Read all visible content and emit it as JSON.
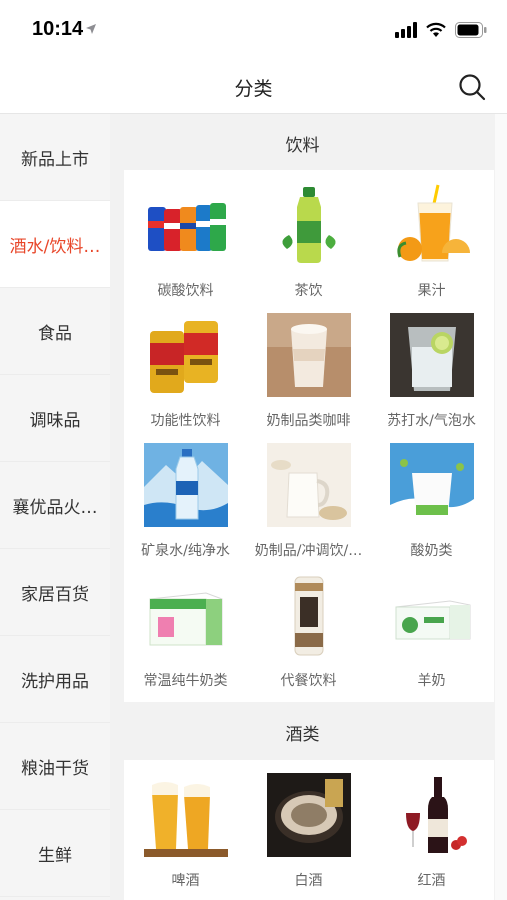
{
  "status": {
    "time": "10:14"
  },
  "header": {
    "title": "分类"
  },
  "sidebar": {
    "items": [
      {
        "label": "新品上市",
        "active": false
      },
      {
        "label": "酒水/饮料…",
        "active": true
      },
      {
        "label": "食品",
        "active": false
      },
      {
        "label": "调味品",
        "active": false
      },
      {
        "label": "襄优品火…",
        "active": false
      },
      {
        "label": "家居百货",
        "active": false
      },
      {
        "label": "洗护用品",
        "active": false
      },
      {
        "label": "粮油干货",
        "active": false
      },
      {
        "label": "生鲜",
        "active": false
      }
    ]
  },
  "sections": [
    {
      "title": "饮料",
      "items": [
        {
          "label": "碳酸饮料",
          "icon": "soda-cans-icon"
        },
        {
          "label": "茶饮",
          "icon": "green-tea-bottle-icon"
        },
        {
          "label": "果汁",
          "icon": "orange-juice-icon"
        },
        {
          "label": "功能性饮料",
          "icon": "energy-drink-cans-icon"
        },
        {
          "label": "奶制品类咖啡",
          "icon": "milk-coffee-icon"
        },
        {
          "label": "苏打水/气泡水",
          "icon": "soda-water-glass-icon"
        },
        {
          "label": "矿泉水/纯净水",
          "icon": "mineral-water-bottle-icon"
        },
        {
          "label": "奶制品/冲调饮/…",
          "icon": "milk-jug-icon"
        },
        {
          "label": "酸奶类",
          "icon": "yogurt-cup-icon"
        },
        {
          "label": "常温纯牛奶类",
          "icon": "milk-box-icon"
        },
        {
          "label": "代餐饮料",
          "icon": "meal-drink-can-icon"
        },
        {
          "label": "羊奶",
          "icon": "goat-milk-box-icon"
        }
      ]
    },
    {
      "title": "酒类",
      "items": [
        {
          "label": "啤酒",
          "icon": "beer-glasses-icon"
        },
        {
          "label": "白酒",
          "icon": "baijiu-bowl-icon"
        },
        {
          "label": "红酒",
          "icon": "red-wine-bottle-icon"
        }
      ]
    }
  ],
  "colors": {
    "accent": "#e8472a",
    "sidebar_bg": "#f5f5f5",
    "main_bg": "#f2f2f2"
  }
}
